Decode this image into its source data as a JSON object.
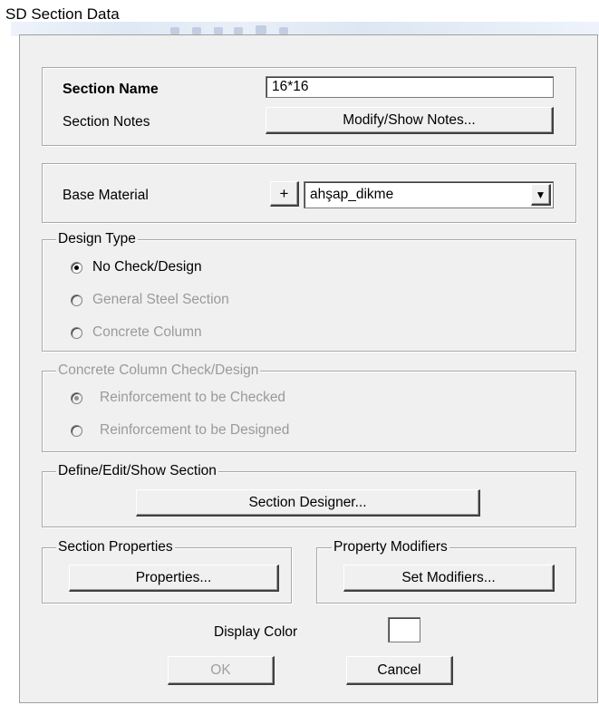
{
  "window": {
    "title": "SD Section Data"
  },
  "section": {
    "name_label": "Section Name",
    "name_value": "16*16",
    "notes_label": "Section Notes",
    "notes_button": "Modify/Show Notes..."
  },
  "material": {
    "label": "Base Material",
    "add_button": "+",
    "selected": "ahşap_dikme",
    "dropdown_icon": "▼"
  },
  "design_type": {
    "legend": "Design Type",
    "options": [
      {
        "label": "No Check/Design",
        "selected": true,
        "enabled": true
      },
      {
        "label": "General Steel Section",
        "selected": false,
        "enabled": false
      },
      {
        "label": "Concrete Column",
        "selected": false,
        "enabled": false
      }
    ]
  },
  "concrete_column": {
    "legend": "Concrete Column Check/Design",
    "options": [
      {
        "label": "Reinforcement to be Checked",
        "selected": true,
        "enabled": false
      },
      {
        "label": "Reinforcement to be Designed",
        "selected": false,
        "enabled": false
      }
    ]
  },
  "define_section": {
    "legend": "Define/Edit/Show Section",
    "button": "Section Designer..."
  },
  "section_properties": {
    "legend": "Section Properties",
    "button": "Properties..."
  },
  "property_modifiers": {
    "legend": "Property Modifiers",
    "button": "Set Modifiers..."
  },
  "display_color": {
    "label": "Display Color",
    "color": "#ffffff"
  },
  "actions": {
    "ok": "OK",
    "cancel": "Cancel"
  }
}
